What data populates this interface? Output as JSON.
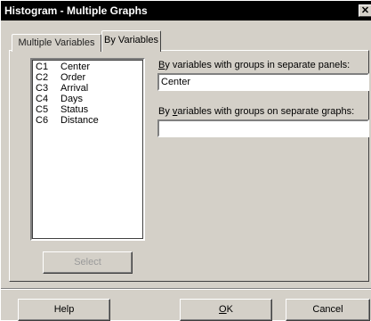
{
  "window": {
    "title": "Histogram - Multiple Graphs",
    "close_glyph": "✕"
  },
  "tabs": [
    {
      "label": "Multiple Variables",
      "active": false
    },
    {
      "label": "By Variables",
      "active": true
    }
  ],
  "variables": [
    {
      "id": "C1",
      "name": "Center"
    },
    {
      "id": "C2",
      "name": "Order"
    },
    {
      "id": "C3",
      "name": "Arrival"
    },
    {
      "id": "C4",
      "name": "Days"
    },
    {
      "id": "C5",
      "name": "Status"
    },
    {
      "id": "C6",
      "name": "Distance"
    }
  ],
  "panels_field": {
    "label_mnemonic": "B",
    "label_rest": "y variables with groups in separate panels:",
    "value": "Center"
  },
  "graphs_field": {
    "label_before": "By ",
    "label_mnemonic": "v",
    "label_rest": "ariables with groups on separate graphs:",
    "value": ""
  },
  "buttons": {
    "select": "Select",
    "help": "Help",
    "ok_mnemonic": "O",
    "ok_rest": "K",
    "cancel": "Cancel"
  },
  "colors": {
    "dialog_face": "#d4d0c8",
    "titlebar": "#000000",
    "disabled_text": "#9a9a9a"
  }
}
